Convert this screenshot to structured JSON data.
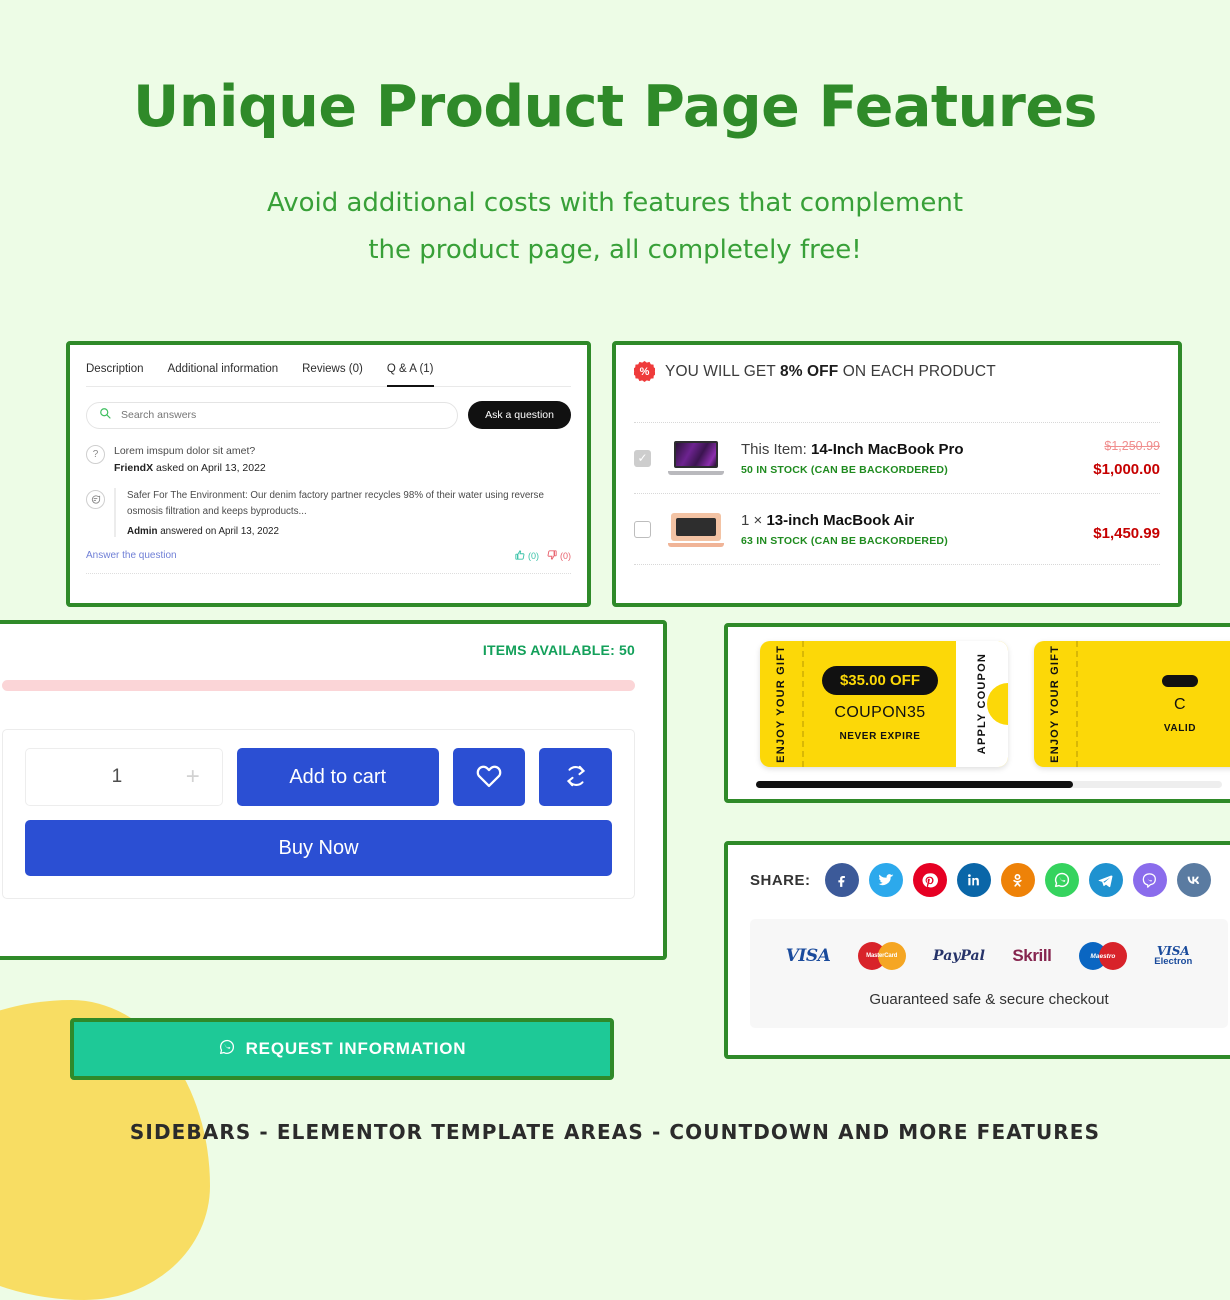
{
  "hero": {
    "title": "Unique Product Page Features",
    "subtitle": "Avoid additional costs with features that complement the product page, all completely free!",
    "title_color": "#2f8a29",
    "subtitle_color": "#38a038",
    "background_color": "#edfce6"
  },
  "qa_panel": {
    "tabs": [
      {
        "label": "Description",
        "active": false
      },
      {
        "label": "Additional information",
        "active": false
      },
      {
        "label": "Reviews (0)",
        "active": false
      },
      {
        "label": "Q & A (1)",
        "active": true
      }
    ],
    "search": {
      "placeholder": "Search answers",
      "value": "",
      "icon": "search-icon"
    },
    "ask_button": "Ask a question",
    "question": {
      "icon": "question-mark-icon",
      "text": "Lorem imspum dolor sit amet?",
      "author": "FriendX",
      "meta": "asked on April 13, 2022"
    },
    "answer": {
      "icon": "speech-bubble-icon",
      "text": "Safer For The Environment: Our denim factory partner recycles 98% of their water using reverse osmosis filtration and keeps byproducts...",
      "author": "Admin",
      "meta": "answered on April 13, 2022"
    },
    "answer_link": "Answer the question",
    "votes": {
      "up_count": "(0)",
      "down_count": "(0)",
      "up_color": "#39c2a8",
      "down_color": "#e8616d"
    }
  },
  "bundle_panel": {
    "badge_icon": "percent-seal-icon",
    "headline_prefix": "YOU WILL GET ",
    "headline_discount": "8% OFF",
    "headline_suffix": " ON EACH PRODUCT",
    "rows": [
      {
        "checked": true,
        "thumb": "macbook-pro-thumbnail",
        "title_plain": "This Item: ",
        "title_bold": "14-Inch MacBook Pro",
        "stock": "50 IN STOCK (CAN BE BACKORDERED)",
        "price_old": "$1,250.99",
        "price_new": "$1,000.00"
      },
      {
        "checked": false,
        "thumb": "macbook-air-thumbnail",
        "title_plain": "1 × ",
        "title_bold": "13-inch MacBook Air",
        "stock": "63 IN STOCK (CAN BE BACKORDERED)",
        "price_old": "",
        "price_new": "$1,450.99"
      }
    ],
    "stock_color": "#1f8b1f",
    "price_color": "#c60000"
  },
  "cart_panel": {
    "items_available": "ITEMS AVAILABLE: 50",
    "items_available_color": "#13a05a",
    "stock_bar_color": "#fbd5d7",
    "quantity": "1",
    "quantity_plus": "+",
    "add_to_cart": "Add to cart",
    "wishlist_icon": "heart-icon",
    "compare_icon": "compare-refresh-icon",
    "buy_now": "Buy Now",
    "accent_color": "#2b4fd3"
  },
  "coupon_panel": {
    "coupons": [
      {
        "side_label": "ENJOY YOUR GIFT",
        "amount": "$35.00 OFF",
        "code": "COUPON35",
        "expiry": "NEVER EXPIRE",
        "apply_label": "APPLY COUPON"
      },
      {
        "side_label": "ENJOY YOUR GIFT",
        "amount": "",
        "code": "C",
        "expiry": "VALID",
        "apply_label": ""
      }
    ],
    "coupon_color": "#fcd808",
    "scroll_position": "68%"
  },
  "share_panel": {
    "share_label": "SHARE:",
    "socials": [
      {
        "name": "facebook-icon",
        "color": "#3c5a99"
      },
      {
        "name": "twitter-icon",
        "color": "#2ca9ec"
      },
      {
        "name": "pinterest-icon",
        "color": "#e60023"
      },
      {
        "name": "linkedin-icon",
        "color": "#0a66a8"
      },
      {
        "name": "odnoklassniki-icon",
        "color": "#ee8208"
      },
      {
        "name": "whatsapp-icon",
        "color": "#35d35e"
      },
      {
        "name": "telegram-icon",
        "color": "#1f92d0"
      },
      {
        "name": "viber-icon",
        "color": "#8a6cec"
      },
      {
        "name": "vk-icon",
        "color": "#5a7ba1"
      }
    ],
    "payments": [
      {
        "name": "visa-logo",
        "label": "VISA"
      },
      {
        "name": "mastercard-logo",
        "label": "MasterCard"
      },
      {
        "name": "paypal-logo",
        "label": "PayPal"
      },
      {
        "name": "skrill-logo",
        "label": "Skrill"
      },
      {
        "name": "maestro-logo",
        "label": "Maestro"
      },
      {
        "name": "visa-electron-logo",
        "label_top": "VISA",
        "label_bottom": "Electron"
      }
    ],
    "secure_note": "Guaranteed safe & secure checkout"
  },
  "request_button": {
    "label": "REQUEST INFORMATION",
    "icon": "whatsapp-icon",
    "background": "#1ec997"
  },
  "footer": {
    "text": "SIDEBARS - ELEMENTOR TEMPLATE AREAS - COUNTDOWN  AND MORE FEATURES"
  }
}
